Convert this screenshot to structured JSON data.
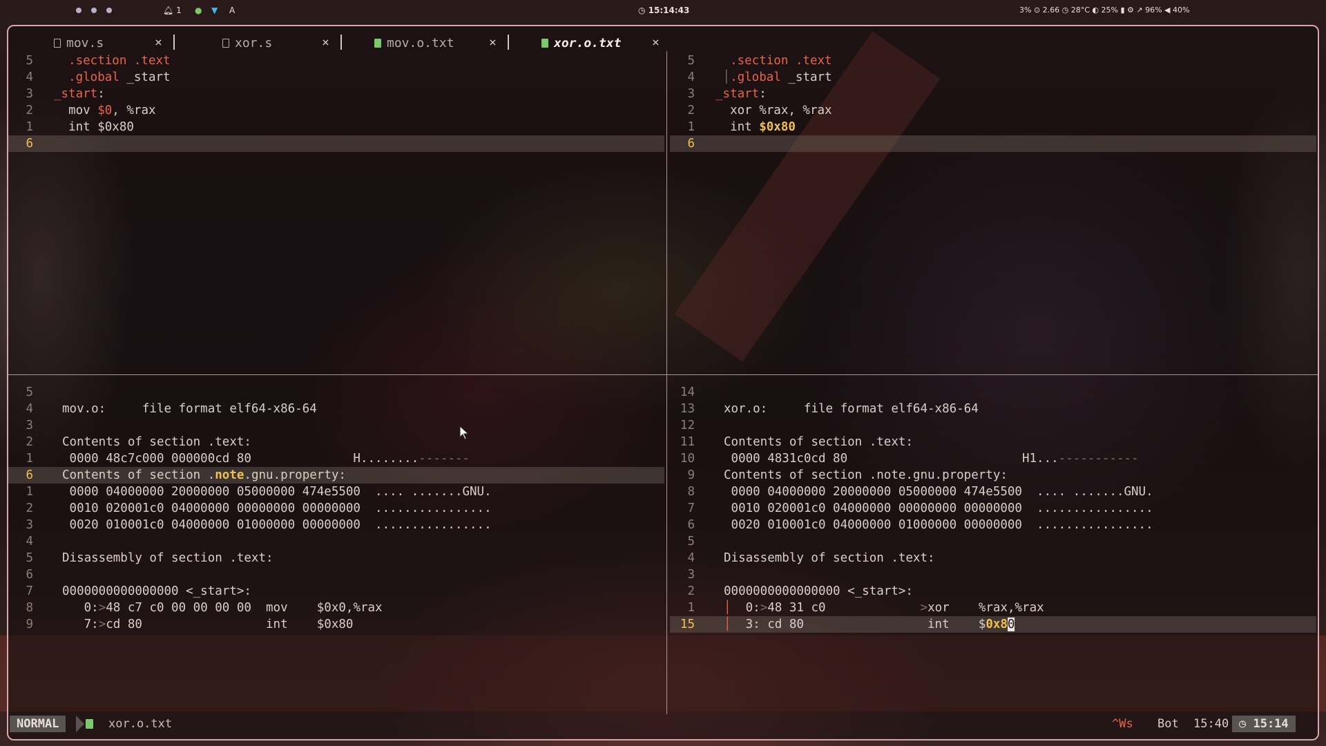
{
  "topbar": {
    "notif_count": "1",
    "lang": "A",
    "clock": "15:14:43",
    "sysinfo": "3% ⊙ 2.66 ◷ 28°C ◐ 25% ▮   ⚙  ↗ 96%   ◀ 40%"
  },
  "tabs": [
    {
      "label": "mov.s"
    },
    {
      "label": "xor.s"
    },
    {
      "label": "mov.o.txt"
    },
    {
      "label": "xor.o.txt"
    }
  ],
  "tab_close": "×",
  "left_src": {
    "lines": [
      {
        "n": "5",
        "parts": [
          [
            "kw",
            "  .section .text"
          ]
        ]
      },
      {
        "n": "4",
        "parts": [
          [
            "kw",
            "  .global"
          ],
          [
            "",
            " _start"
          ]
        ]
      },
      {
        "n": "3",
        "parts": [
          [
            "lbl",
            "_start"
          ],
          [
            "",
            ":"
          ]
        ]
      },
      {
        "n": "2",
        "parts": [
          [
            "",
            "  mov "
          ],
          [
            "num",
            "$0"
          ],
          [
            "",
            ", %rax"
          ]
        ]
      },
      {
        "n": "1",
        "parts": [
          [
            "",
            "  int $0x80"
          ]
        ]
      },
      {
        "n": "6",
        "parts": [],
        "cur": true
      }
    ]
  },
  "right_src": {
    "lines": [
      {
        "n": "5",
        "parts": [
          [
            "kw",
            "  .section .text"
          ]
        ]
      },
      {
        "n": "4",
        "parts": [
          [
            "dim",
            " │"
          ],
          [
            "kw",
            ".global"
          ],
          [
            "",
            " _start"
          ]
        ]
      },
      {
        "n": "3",
        "parts": [
          [
            "lbl",
            "_start"
          ],
          [
            "",
            ":"
          ]
        ]
      },
      {
        "n": "2",
        "parts": [
          [
            "",
            "  xor %rax, %rax"
          ]
        ]
      },
      {
        "n": "1",
        "parts": [
          [
            "",
            "  int "
          ],
          [
            "numy",
            "$0x80"
          ]
        ]
      },
      {
        "n": "6",
        "parts": [],
        "cur": true
      }
    ]
  },
  "left_dump": {
    "lines": [
      {
        "n": "5",
        "parts": []
      },
      {
        "n": "4",
        "parts": [
          [
            "",
            "mov.o:     file format elf64-x86-64"
          ]
        ]
      },
      {
        "n": "3",
        "parts": []
      },
      {
        "n": "2",
        "parts": [
          [
            "",
            "Contents of section .text:"
          ]
        ]
      },
      {
        "n": "1",
        "parts": [
          [
            "",
            " 0000 48c7c000 000000cd 80              H........"
          ],
          [
            "dim",
            "-------"
          ]
        ]
      },
      {
        "n": "6",
        "parts": [
          [
            "",
            "Contents of section ."
          ],
          [
            "bold",
            "note"
          ],
          [
            "",
            ".gnu.property:"
          ]
        ],
        "cur": true
      },
      {
        "n": "1",
        "parts": [
          [
            "",
            " 0000 04000000 20000000 05000000 474e5500  .... .......GNU."
          ]
        ]
      },
      {
        "n": "2",
        "parts": [
          [
            "",
            " 0010 020001c0 04000000 00000000 00000000  ................"
          ]
        ]
      },
      {
        "n": "3",
        "parts": [
          [
            "",
            " 0020 010001c0 04000000 01000000 00000000  ................"
          ]
        ]
      },
      {
        "n": "4",
        "parts": []
      },
      {
        "n": "5",
        "parts": [
          [
            "",
            "Disassembly of section .text:"
          ]
        ]
      },
      {
        "n": "6",
        "parts": []
      },
      {
        "n": "7",
        "parts": [
          [
            "",
            "0000000000000000 <_start>:"
          ]
        ]
      },
      {
        "n": "8",
        "parts": [
          [
            "",
            "   0:"
          ],
          [
            "dim",
            ">"
          ],
          [
            "",
            "48 c7 c0 00 00 00 00  mov    $0x0,%rax"
          ]
        ]
      },
      {
        "n": "9",
        "parts": [
          [
            "",
            "   7:"
          ],
          [
            "dim",
            ">"
          ],
          [
            "",
            "cd 80                 int    $0x80"
          ]
        ]
      }
    ]
  },
  "right_dump": {
    "lines": [
      {
        "n": "14",
        "parts": []
      },
      {
        "n": "13",
        "parts": [
          [
            "",
            "xor.o:     file format elf64-x86-64"
          ]
        ]
      },
      {
        "n": "12",
        "parts": []
      },
      {
        "n": "11",
        "parts": [
          [
            "",
            "Contents of section .text:"
          ]
        ]
      },
      {
        "n": "10",
        "parts": [
          [
            "",
            " 0000 4831c0cd 80                        H1..."
          ],
          [
            "dim",
            "-----------"
          ]
        ]
      },
      {
        "n": "9",
        "parts": [
          [
            "",
            "Contents of section .note.gnu.property:"
          ]
        ]
      },
      {
        "n": "8",
        "parts": [
          [
            "",
            " 0000 04000000 20000000 05000000 474e5500  .... .......GNU."
          ]
        ]
      },
      {
        "n": "7",
        "parts": [
          [
            "",
            " 0010 020001c0 04000000 00000000 00000000  ................"
          ]
        ]
      },
      {
        "n": "6",
        "parts": [
          [
            "",
            " 0020 010001c0 04000000 01000000 00000000  ................"
          ]
        ]
      },
      {
        "n": "5",
        "parts": []
      },
      {
        "n": "4",
        "parts": [
          [
            "",
            "Disassembly of section .text:"
          ]
        ]
      },
      {
        "n": "3",
        "parts": []
      },
      {
        "n": "2",
        "parts": [
          [
            "",
            "0000000000000000 <_start>:"
          ]
        ]
      },
      {
        "n": "1",
        "parts": [
          [
            "kw",
            "│"
          ],
          [
            "",
            "  0:"
          ],
          [
            "dim",
            ">"
          ],
          [
            "",
            "48 31 c0             "
          ],
          [
            "dim",
            ">"
          ],
          [
            "",
            "xor    %rax,%rax"
          ]
        ]
      },
      {
        "n": "15",
        "parts": [
          [
            "kw",
            "│"
          ],
          [
            "",
            "  3: cd 80                 int    $"
          ],
          [
            "numy",
            "0x8"
          ],
          [
            "cursor",
            "0"
          ]
        ],
        "cur": true
      }
    ]
  },
  "status": {
    "mode": "NORMAL",
    "file": "xor.o.txt",
    "keys": "^Ws",
    "pos": "Bot",
    "lc": "15:40",
    "time": "◷ 15:14"
  }
}
